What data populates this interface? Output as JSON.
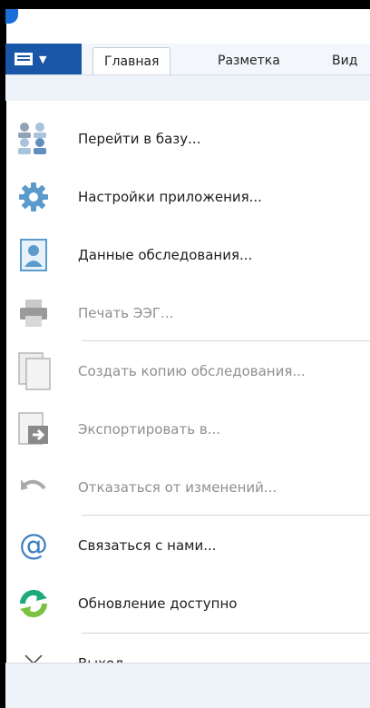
{
  "ribbon": {
    "tabs": [
      {
        "label": "Главная",
        "active": true
      },
      {
        "label": "Разметка",
        "active": false
      },
      {
        "label": "Вид",
        "active": false
      }
    ]
  },
  "menu": {
    "items": [
      {
        "label": "Перейти в базу...",
        "icon": "users-icon",
        "enabled": true
      },
      {
        "label": "Настройки приложения...",
        "icon": "gear-icon",
        "enabled": true
      },
      {
        "label": "Данные обследования...",
        "icon": "patient-card-icon",
        "enabled": true
      },
      {
        "label": "Печать ЭЭГ...",
        "icon": "printer-icon",
        "enabled": false
      },
      {
        "label": "Создать копию обследования...",
        "icon": "copy-icon",
        "enabled": false
      },
      {
        "label": "Экспортировать в...",
        "icon": "export-icon",
        "enabled": false
      },
      {
        "label": "Отказаться от изменений...",
        "icon": "undo-icon",
        "enabled": false
      },
      {
        "label": "Связаться с нами...",
        "icon": "at-icon",
        "enabled": true
      },
      {
        "label": "Обновление доступно",
        "icon": "update-icon",
        "enabled": true
      },
      {
        "label": "Выход",
        "icon": "close-icon",
        "enabled": true
      }
    ]
  },
  "colors": {
    "accent": "#1a56a8",
    "disabled_text": "#8f8f8f"
  }
}
